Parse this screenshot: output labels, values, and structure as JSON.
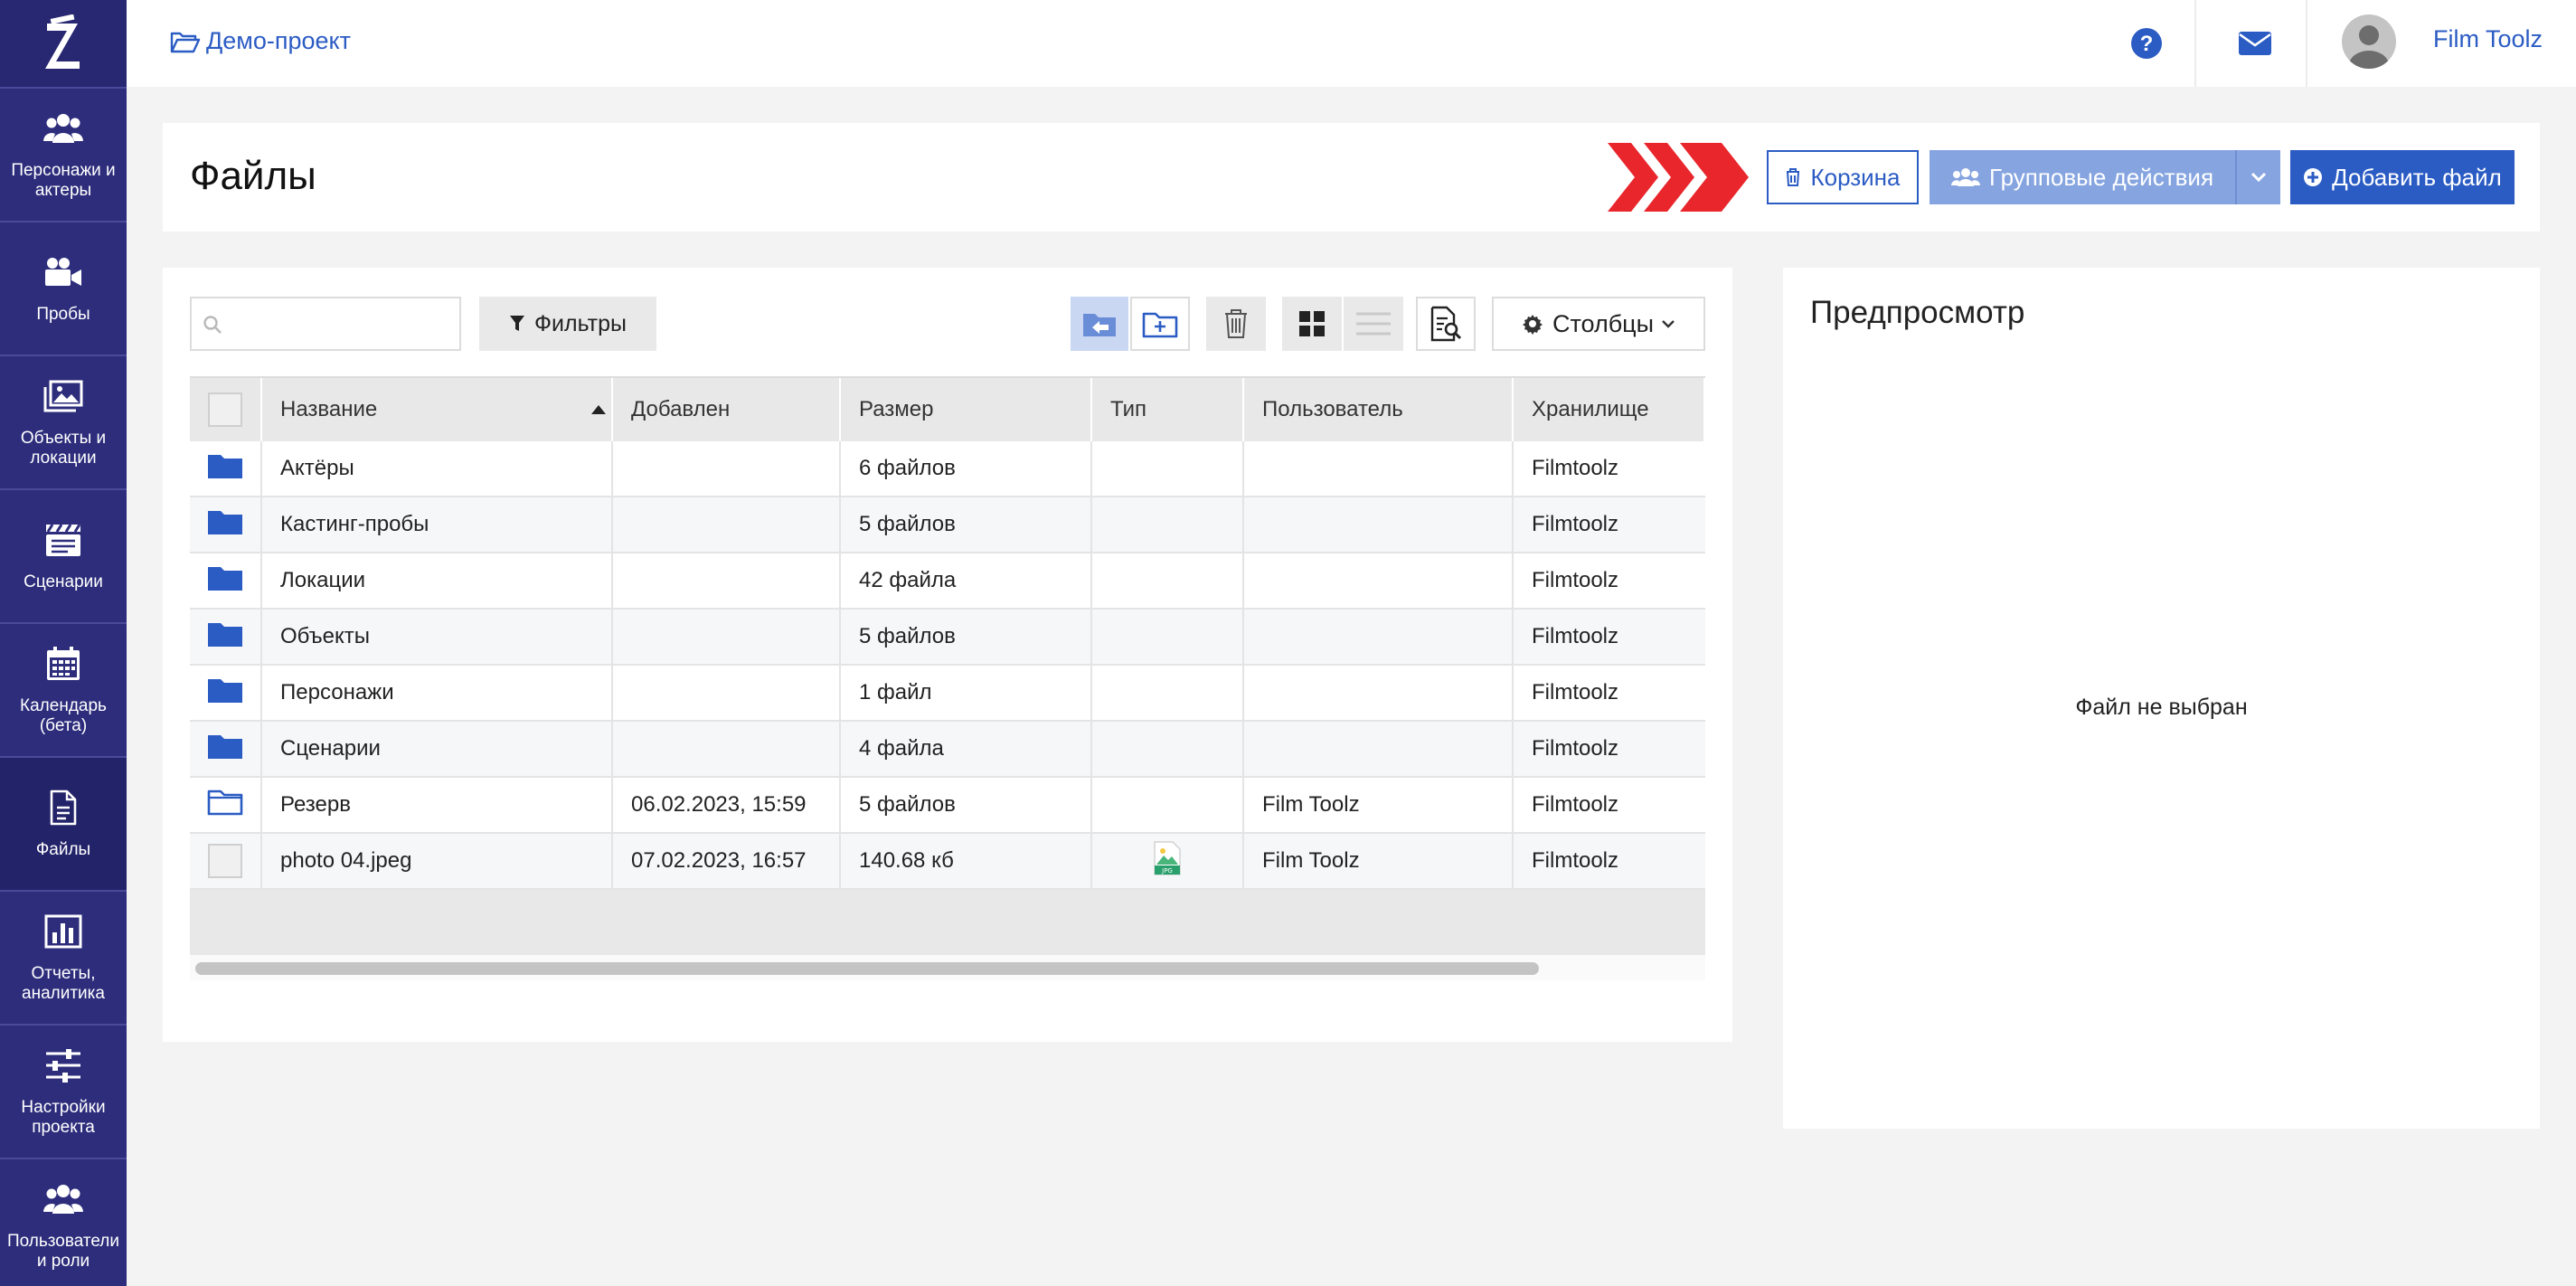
{
  "sidebar": {
    "items": [
      {
        "label": "Персонажи и актеры",
        "icon": "users-icon"
      },
      {
        "label": "Пробы",
        "icon": "video-camera-icon"
      },
      {
        "label": "Объекты и локации",
        "icon": "image-icon"
      },
      {
        "label": "Сценарии",
        "icon": "clapperboard-icon"
      },
      {
        "label": "Календарь (бета)",
        "icon": "calendar-icon"
      },
      {
        "label": "Файлы",
        "icon": "file-icon",
        "active": true
      },
      {
        "label": "Отчеты, аналитика",
        "icon": "bar-chart-icon"
      },
      {
        "label": "Настройки проекта",
        "icon": "sliders-icon"
      },
      {
        "label": "Пользователи и роли",
        "icon": "users-icon"
      }
    ]
  },
  "topbar": {
    "breadcrumb": "Демо-проект",
    "username": "Film Toolz"
  },
  "header": {
    "title": "Файлы",
    "trash_label": "Корзина",
    "group_actions_label": "Групповые действия",
    "add_file_label": "Добавить файл"
  },
  "toolbar": {
    "search_placeholder": "",
    "filters_label": "Фильтры",
    "columns_label": "Столбцы"
  },
  "table": {
    "columns": [
      "Название",
      "Добавлен",
      "Размер",
      "Тип",
      "Пользователь",
      "Хранилище"
    ],
    "rows": [
      {
        "kind": "folder",
        "name": "Актёры",
        "added": "",
        "size": "6 файлов",
        "type": "",
        "user": "",
        "storage": "Filmtoolz"
      },
      {
        "kind": "folder",
        "name": "Кастинг-пробы",
        "added": "",
        "size": "5 файлов",
        "type": "",
        "user": "",
        "storage": "Filmtoolz"
      },
      {
        "kind": "folder",
        "name": "Локации",
        "added": "",
        "size": "42 файла",
        "type": "",
        "user": "",
        "storage": "Filmtoolz"
      },
      {
        "kind": "folder",
        "name": "Объекты",
        "added": "",
        "size": "5 файлов",
        "type": "",
        "user": "",
        "storage": "Filmtoolz"
      },
      {
        "kind": "folder",
        "name": "Персонажи",
        "added": "",
        "size": "1 файл",
        "type": "",
        "user": "",
        "storage": "Filmtoolz"
      },
      {
        "kind": "folder",
        "name": "Сценарии",
        "added": "",
        "size": "4 файла",
        "type": "",
        "user": "",
        "storage": "Filmtoolz"
      },
      {
        "kind": "folder-outline",
        "name": "Резерв",
        "added": "06.02.2023, 15:59",
        "size": "5 файлов",
        "type": "",
        "user": "Film Toolz",
        "storage": "Filmtoolz"
      },
      {
        "kind": "file",
        "name": "photo 04.jpeg",
        "added": "07.02.2023, 16:57",
        "size": "140.68 кб",
        "type": "JPG",
        "user": "Film Toolz",
        "storage": "Filmtoolz"
      }
    ]
  },
  "preview": {
    "title": "Предпросмотр",
    "empty_text": "Файл не выбран"
  },
  "colors": {
    "sidebar": "#2d2d7c",
    "accent": "#2b5cc4",
    "group_button": "#86a5e0",
    "chevron_red": "#e8262c"
  }
}
